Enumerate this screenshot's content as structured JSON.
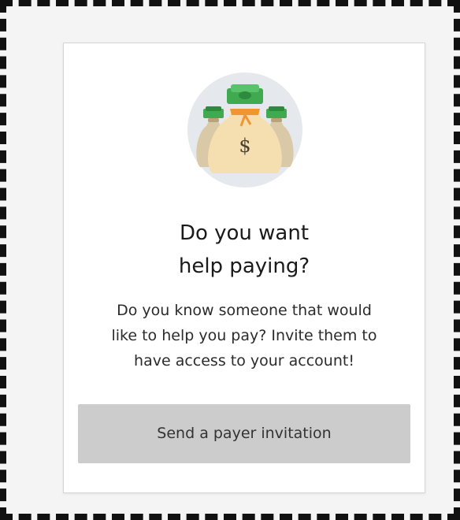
{
  "card": {
    "illustration_icon": "money-bags-icon",
    "title_line1": "Do you want",
    "title_line2": "help paying?",
    "description_line1": "Do you know someone that would",
    "description_line2": "like to help you pay? Invite them to",
    "description_line3": "have access to your account!",
    "button_label": "Send a payer invitation"
  },
  "colors": {
    "button_bg": "#cccccc",
    "illustration_circle": "#e5e8ec",
    "money_green": "#3faa4f",
    "bag_tan": "#f5deb0",
    "bag_tie": "#f0962e"
  }
}
